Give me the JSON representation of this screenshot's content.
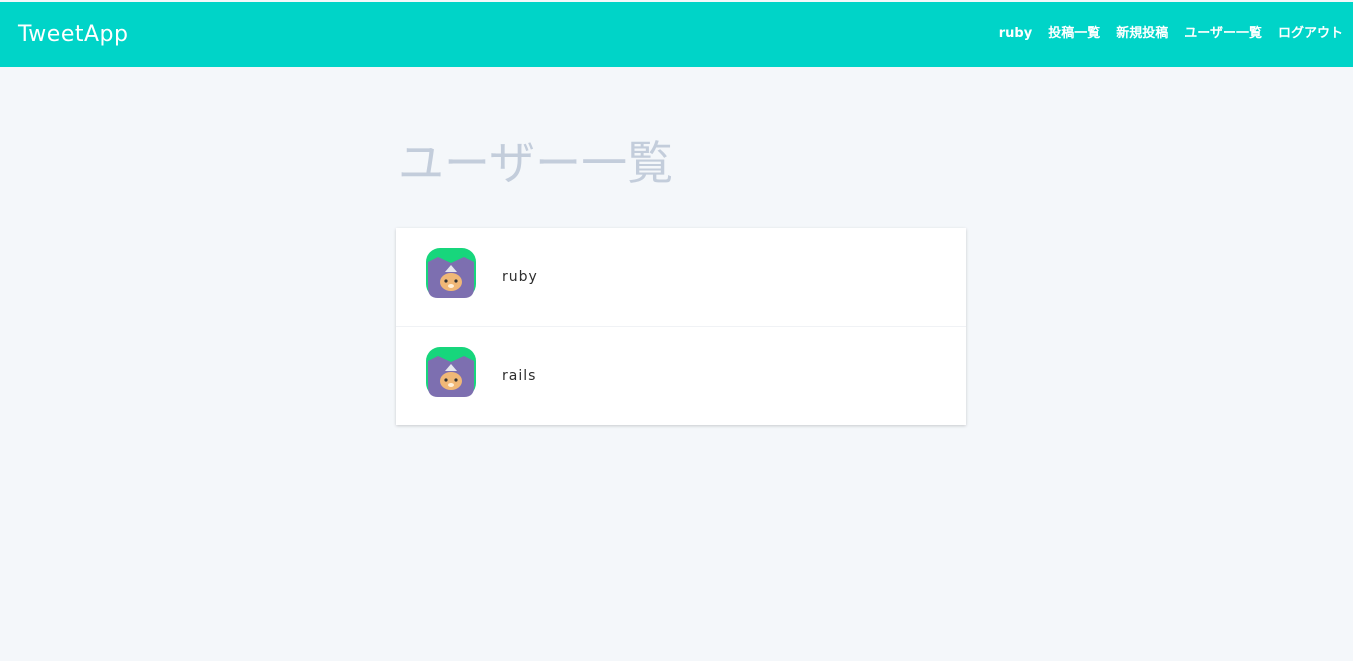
{
  "header": {
    "brand": "TweetApp",
    "nav": [
      "ruby",
      "投稿一覧",
      "新規投稿",
      "ユーザー一覧",
      "ログアウト"
    ]
  },
  "main": {
    "title": "ユーザー一覧",
    "users": [
      {
        "name": "ruby"
      },
      {
        "name": "rails"
      }
    ]
  },
  "colors": {
    "header": "#00d4c8",
    "background": "#f4f7fa",
    "title": "#c3cddb"
  }
}
